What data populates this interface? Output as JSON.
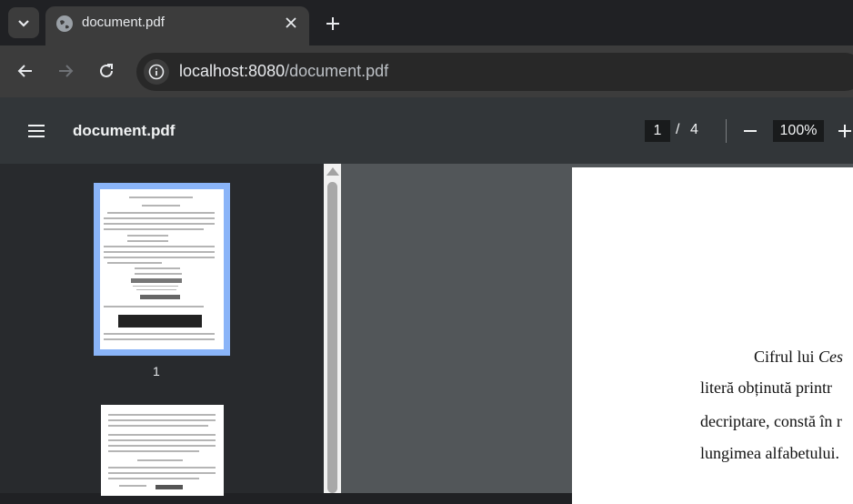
{
  "browser": {
    "tab": {
      "title": "document.pdf"
    },
    "url": {
      "host": "localhost:8080",
      "path": "/document.pdf"
    }
  },
  "pdf_viewer": {
    "title": "document.pdf",
    "current_page": "1",
    "separator": "/",
    "total_pages": "4",
    "zoom": "100%"
  },
  "thumbnails": [
    {
      "label": "1"
    }
  ],
  "document": {
    "lines": [
      {
        "prefix": "Cifrul lui ",
        "italic": "Ces"
      },
      {
        "prefix": "literă obținută printr",
        "italic": ""
      },
      {
        "prefix": "decriptare, constă în r",
        "italic": ""
      },
      {
        "prefix": "lungimea alfabetului.",
        "italic": ""
      }
    ]
  },
  "icons": {
    "tab_search": "chevron-down-icon",
    "favicon": "globe-icon",
    "close": "close-icon",
    "new_tab": "plus-icon",
    "back": "arrow-left-icon",
    "forward": "arrow-right-icon",
    "reload": "reload-icon",
    "site_info": "info-icon",
    "menu": "hamburger-icon",
    "zoom_out": "minus-icon",
    "zoom_in": "plus-icon"
  }
}
